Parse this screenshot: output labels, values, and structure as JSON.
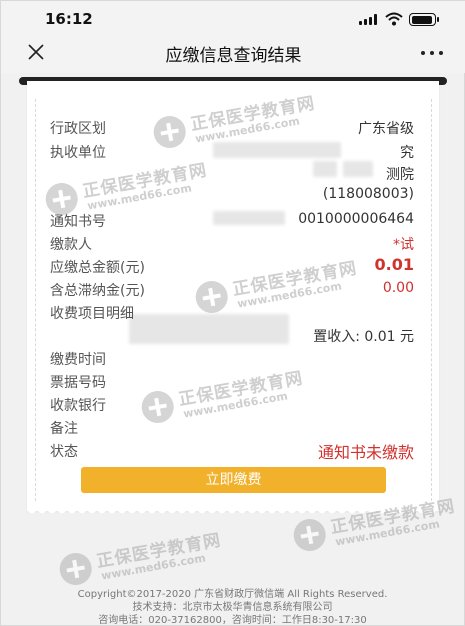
{
  "status": {
    "time": "16:12"
  },
  "nav": {
    "title": "应缴信息查询结果"
  },
  "fields": {
    "region_label": "行政区划",
    "region_value": "广东省级",
    "collector_label": "执收单位",
    "collector_line1": "究",
    "collector_line2": "测院",
    "collector_line3": "(118008003)",
    "notice_label": "通知书号",
    "notice_value": "0010000006464",
    "payer_label": "缴款人",
    "payer_value": "*试",
    "total_label": "应缴总金额(元)",
    "total_value": "0.01",
    "latefee_label": "含总滞纳金(元)",
    "latefee_value": "0.00",
    "items_label": "收费项目明细",
    "items_value": "置收入: 0.01 元",
    "paytime_label": "缴费时间",
    "receipt_label": "票据号码",
    "bank_label": "收款银行",
    "remark_label": "备注",
    "state_label": "状态",
    "state_value": "通知书未缴款"
  },
  "pay_button": "立即缴费",
  "footer": {
    "copyright": "Copyright©2017-2020 广东省财政厅微信端 All Rights Reserved.",
    "support": "技术支持：北京市太极华青信息系统有限公司",
    "contact": "咨询电话：020-37162800，咨询时间：工作日8:30-17:30"
  },
  "watermark": {
    "text": "正保医学教育网",
    "url": "www.med66.com"
  },
  "colors": {
    "accent_red": "#d0322e",
    "button_yellow": "#f2b12b"
  },
  "icons": [
    "close-icon",
    "more-icon",
    "signal-icon",
    "wifi-icon",
    "battery-icon"
  ]
}
